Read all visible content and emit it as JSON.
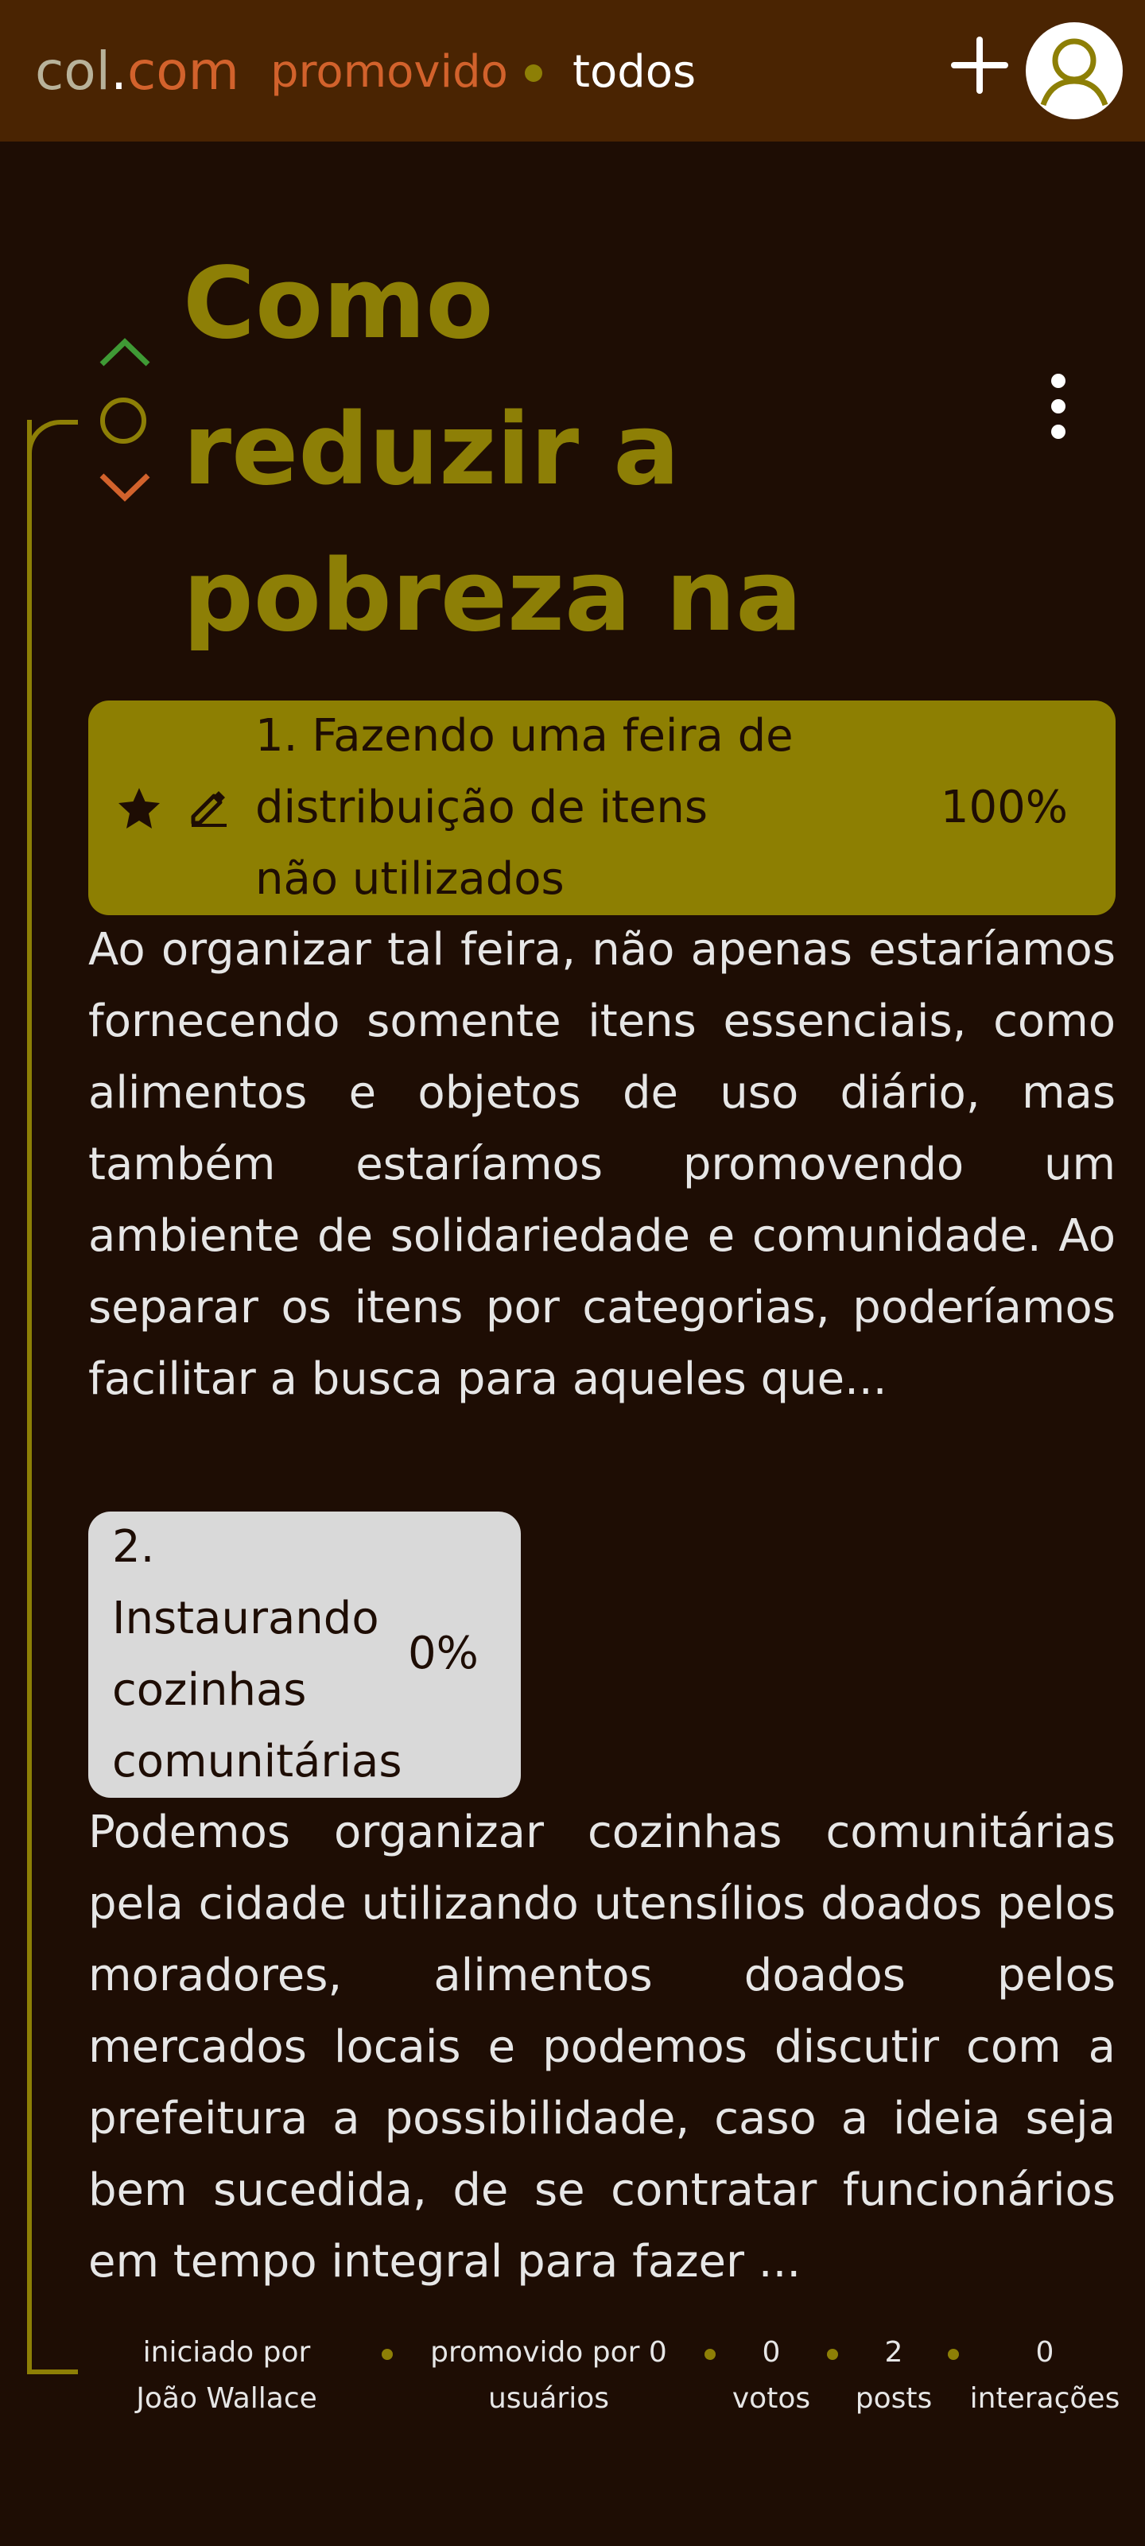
{
  "header": {
    "brand_part1": "col",
    "brand_dot": ".",
    "brand_part2": "com",
    "nav_promovido": "promovido",
    "nav_todos": "todos",
    "add_icon": "plus-icon",
    "avatar_icon": "user-icon"
  },
  "post": {
    "title": "Como reduzir a pobreza na cidade?",
    "vote_up_icon": "chevron-up-icon",
    "vote_neutral_icon": "circle-icon",
    "vote_down_icon": "chevron-down-icon",
    "more_icon": "more-vertical-icon"
  },
  "proposals": [
    {
      "label": "1. Fazendo uma feira de distribuição de itens não utilizados",
      "percent": "100%",
      "description": "Ao organizar tal feira, não apenas estaríamos fornecendo somente itens essenciais, como alimentos e objetos de uso diário, mas também estaríamos promovendo um ambiente de solidariedade e comunidade. Ao separar os itens por categorias, poderíamos facilitar a busca para aqueles que..."
    },
    {
      "label": "2. Instaurando cozinhas comunitárias",
      "percent": "0%",
      "description": "Podemos organizar cozinhas comunitárias pela cidade utilizando utensílios doados pelos moradores, alimentos doados pelos mercados locais e podemos discutir com a prefeitura a possibilidade, caso a ideia seja bem sucedida, de se contratar funcionários em tempo integral para fazer ..."
    }
  ],
  "stats": {
    "started_by": "iniciado por João Wallace",
    "promoted_by": "promovido por 0 usuários",
    "votes_count": "0",
    "votes_label": "votos",
    "posts_count": "2",
    "posts_label": "posts",
    "interactions_count": "0",
    "interactions_label": "interações"
  },
  "colors": {
    "background": "#1e0d04",
    "header": "#4a2402",
    "accent_olive": "#8d7f06",
    "accent_orange": "#d2622c",
    "up_green": "#3f9a35"
  }
}
